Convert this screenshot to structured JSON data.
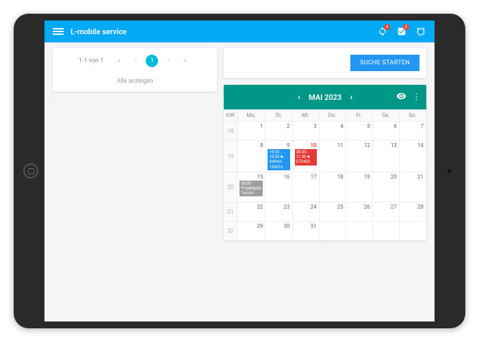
{
  "header": {
    "title": "L-mobile service",
    "badge1": "4",
    "badge2": "2"
  },
  "left": {
    "pagination": {
      "info": "1-1 von 1",
      "first": "«",
      "prev": "‹",
      "page": "1",
      "next": "›",
      "last": "»"
    },
    "showAll": "Alle anzeigen"
  },
  "search": {
    "button": "SUCHE STARTEN"
  },
  "calendar": {
    "title": "MAI 2023",
    "kwLabel": "KW",
    "days": [
      "Mo.",
      "Di.",
      "Mi.",
      "Do.",
      "Fr.",
      "Sa.",
      "So."
    ],
    "weeks": [
      {
        "kw": "18",
        "nums": [
          "1",
          "2",
          "3",
          "4",
          "5",
          "6",
          "7"
        ]
      },
      {
        "kw": "19",
        "nums": [
          "8",
          "9",
          "10",
          "11",
          "12",
          "13",
          "14"
        ],
        "today": 2,
        "events": {
          "1": [
            {
              "cls": "ev-blue",
              "text": "14:55 - 15:55\n■ AdHoc-130016"
            }
          ],
          "2": [
            {
              "cls": "ev-red",
              "text": "08:30 - 11:30\n■ S70400"
            }
          ]
        }
      },
      {
        "kw": "20",
        "nums": [
          "15",
          "16",
          "17",
          "18",
          "19",
          "20",
          "21"
        ],
        "events": {
          "0": [
            {
              "cls": "ev-grey",
              "text": "08:00\nProjektplan Termin"
            }
          ]
        }
      },
      {
        "kw": "21",
        "nums": [
          "22",
          "23",
          "24",
          "25",
          "26",
          "27",
          "28"
        ]
      },
      {
        "kw": "22",
        "nums": [
          "29",
          "30",
          "31",
          "",
          "",
          "",
          ""
        ]
      }
    ]
  }
}
